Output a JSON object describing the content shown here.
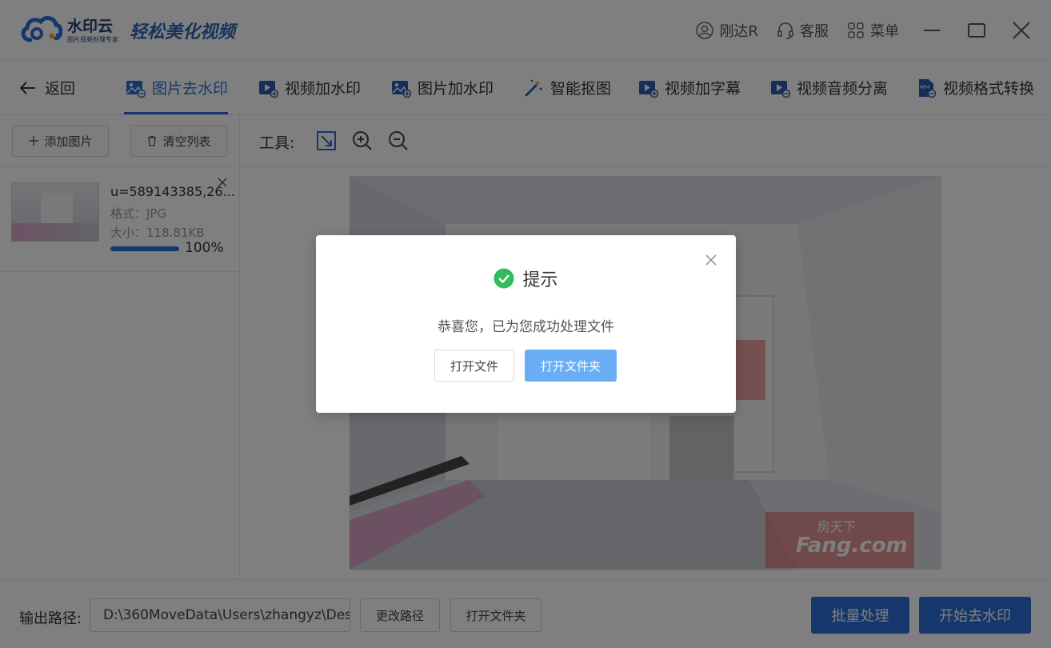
{
  "app": {
    "brand": "水印云",
    "brand_sub": "图片视频处理专家",
    "slogan": "轻松美化视频"
  },
  "titlebar": {
    "user": "刚达R",
    "service": "客服",
    "menu": "菜单"
  },
  "nav": {
    "back": "返回",
    "tabs": [
      {
        "label": "图片去水印",
        "icon": "image-remove-icon",
        "active": true
      },
      {
        "label": "视频加水印",
        "icon": "video-add-icon"
      },
      {
        "label": "图片加水印",
        "icon": "image-add-icon"
      },
      {
        "label": "智能抠图",
        "icon": "magic-wand-icon"
      },
      {
        "label": "视频加字幕",
        "icon": "video-subtitle-icon"
      },
      {
        "label": "视频音频分离",
        "icon": "video-audio-icon"
      },
      {
        "label": "视频格式转换",
        "icon": "mp4-icon"
      }
    ]
  },
  "left": {
    "add_label": "添加图片",
    "clear_label": "清空列表",
    "file": {
      "name": "u=589143385,26...",
      "format": "格式：JPG",
      "size": "大小：118.81KB",
      "progress": 1.0,
      "progress_text": "100%"
    }
  },
  "editor": {
    "tools_label": "工具:"
  },
  "bottom": {
    "output_label": "输出路径:",
    "output_path": "D:\\360MoveData\\Users\\zhangyz\\Des",
    "change_path": "更改路径",
    "open_folder": "打开文件夹",
    "batch": "批量处理",
    "start": "开始去水印"
  },
  "image": {
    "watermark_text": "房天下",
    "watermark_text2": "Fang.com"
  },
  "modal": {
    "title": "提示",
    "message": "恭喜您，已为您成功处理文件",
    "open_file": "打开文件",
    "open_folder": "打开文件夹"
  },
  "colors": {
    "accent": "#2d6fd6",
    "modal_primary": "#69aef5",
    "success": "#2ebd59",
    "watermark_box": "#e85a5a"
  }
}
